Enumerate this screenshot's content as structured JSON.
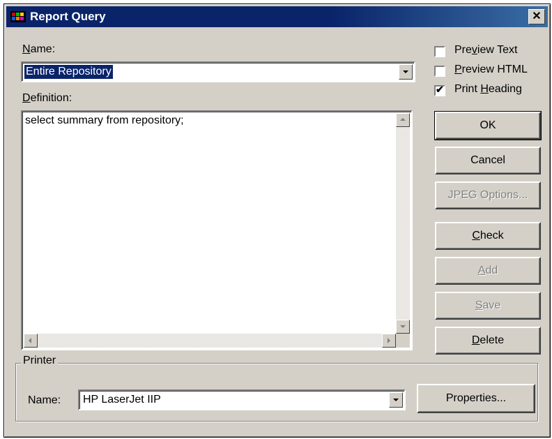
{
  "window": {
    "title": "Report Query",
    "close_label": "✕"
  },
  "name_field": {
    "label_underlined": "N",
    "label_rest": "ame:",
    "value": "Entire Repository"
  },
  "definition": {
    "label_underlined": "D",
    "label_rest": "efinition:",
    "text": "select summary from repository;"
  },
  "options": {
    "preview_text": {
      "pre": "Pre",
      "ul": "v",
      "post": "iew Text",
      "checked": false
    },
    "preview_html": {
      "pre": "",
      "ul": "P",
      "post": "review HTML",
      "checked": false
    },
    "print_heading": {
      "pre": "Print ",
      "ul": "H",
      "post": "eading",
      "checked": true
    }
  },
  "buttons": {
    "ok": "OK",
    "cancel": "Cancel",
    "jpeg": "JPEG Options...",
    "check": {
      "ul": "C",
      "rest": "heck"
    },
    "add": {
      "ul": "A",
      "rest": "dd"
    },
    "save": {
      "ul": "S",
      "rest": "ave"
    },
    "delete": {
      "ul": "D",
      "rest": "elete"
    }
  },
  "printer": {
    "group_label": "Printer",
    "name_label": "Name:",
    "value": "HP LaserJet IIP",
    "properties": "Properties..."
  }
}
